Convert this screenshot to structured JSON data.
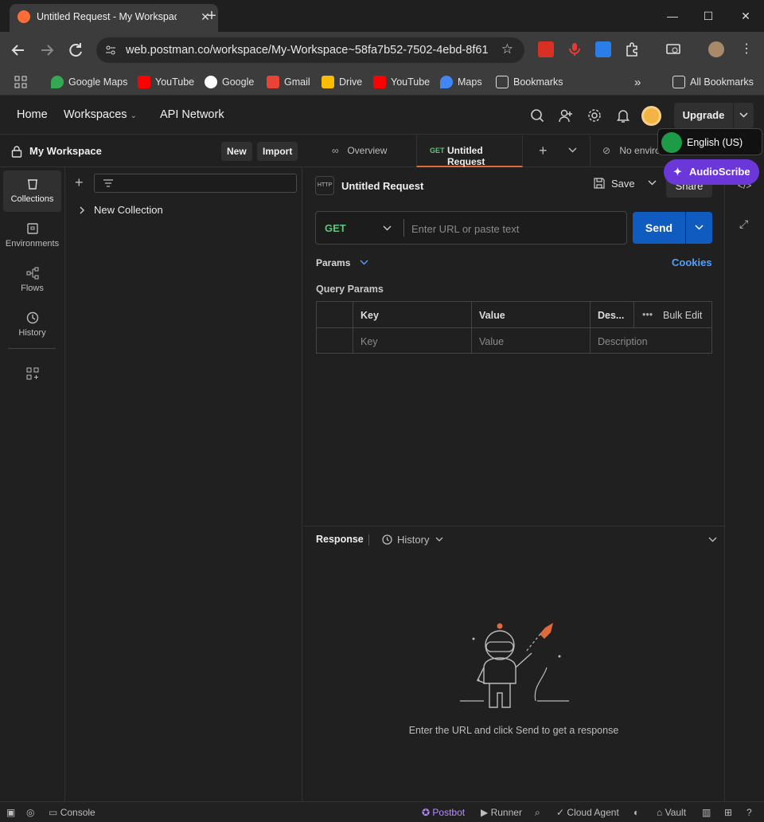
{
  "browser": {
    "tab_title": "Untitled Request - My Workspace",
    "url": "web.postman.co/workspace/My-Workspace~58fa7b52-7502-4ebd-8f61...",
    "bookmarks": [
      "Google Maps",
      "YouTube",
      "Google",
      "Gmail",
      "Drive",
      "YouTube",
      "Maps",
      "Bookmarks"
    ],
    "all_bookmarks": "All Bookmarks"
  },
  "header": {
    "nav": {
      "home": "Home",
      "workspaces": "Workspaces",
      "api_network": "API Network"
    },
    "upgrade": "Upgrade"
  },
  "workspace": {
    "name": "My Workspace",
    "new": "New",
    "import": "Import"
  },
  "rail": {
    "collections": "Collections",
    "environments": "Environments",
    "flows": "Flows",
    "history": "History"
  },
  "collections": {
    "items": [
      "New Collection"
    ]
  },
  "tabs": {
    "overview": "Overview",
    "active_method": "GET",
    "active_title": "Untitled Request",
    "environment": "No enviro"
  },
  "request": {
    "title": "Untitled Request",
    "save": "Save",
    "share": "Share",
    "method": "GET",
    "url_placeholder": "Enter URL or paste text",
    "send": "Send",
    "params": "Params",
    "cookies": "Cookies",
    "query_params": "Query Params",
    "table": {
      "headers": {
        "key": "Key",
        "value": "Value",
        "description": "Des...",
        "bulk_edit": "Bulk Edit"
      },
      "placeholders": {
        "key": "Key",
        "value": "Value",
        "description": "Description"
      }
    }
  },
  "response": {
    "label": "Response",
    "history": "History",
    "hint": "Enter the URL and click Send to get a response"
  },
  "footer": {
    "console": "Console",
    "postbot": "Postbot",
    "runner": "Runner",
    "cloud_agent": "Cloud Agent",
    "vault": "Vault"
  },
  "overlays": {
    "language": "English (US)",
    "audioscribe": "AudioScribe"
  },
  "colors": {
    "send": "#0f5bc0",
    "get_method": "#5bc67a",
    "accent": "#ff6c37",
    "link": "#4ea1ff"
  }
}
